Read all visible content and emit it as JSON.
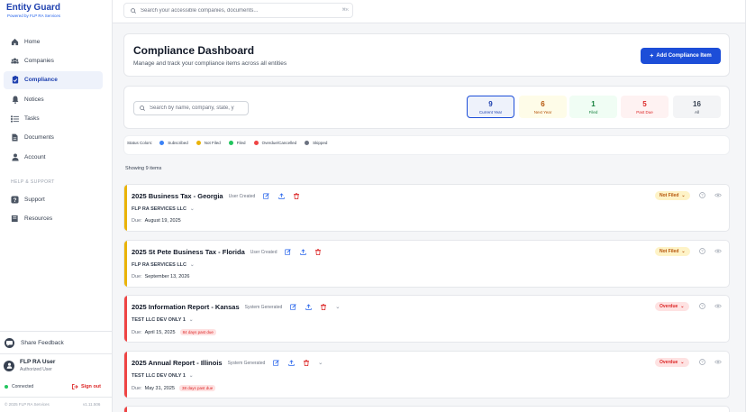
{
  "brand": {
    "title": "Entity Guard",
    "subtitle": "Powered by FLP RA Services"
  },
  "nav": {
    "items": [
      {
        "label": "Home",
        "icon": "home-icon"
      },
      {
        "label": "Companies",
        "icon": "users-icon"
      },
      {
        "label": "Compliance",
        "icon": "clipboard-icon"
      },
      {
        "label": "Notices",
        "icon": "bell-icon"
      },
      {
        "label": "Tasks",
        "icon": "list-icon"
      },
      {
        "label": "Documents",
        "icon": "document-icon"
      },
      {
        "label": "Account",
        "icon": "user-icon"
      }
    ],
    "section": "HELP & SUPPORT",
    "help_items": [
      {
        "label": "Support",
        "icon": "help-icon"
      },
      {
        "label": "Resources",
        "icon": "book-icon"
      }
    ]
  },
  "feedback": "Share Feedback",
  "user": {
    "name": "FLP RA User",
    "role": "Authorized User"
  },
  "status": {
    "connected": "Connected",
    "signout": "Sign out"
  },
  "footer": {
    "copyright": "© 2025 FLP RA Services",
    "version": "v1.11.506"
  },
  "topbar": {
    "search_placeholder": "Search your accessible companies, documents...",
    "shortcut": "⌘K"
  },
  "header": {
    "title": "Compliance Dashboard",
    "subtitle": "Manage and track your compliance items across all entities",
    "add_label": "Add Compliance Item"
  },
  "filter": {
    "search_placeholder": "Search by name, company, state, y",
    "stats": [
      {
        "count": "9",
        "label": "Current Year",
        "color": "#1e40af"
      },
      {
        "count": "6",
        "label": "Next Year",
        "color": "#b45309"
      },
      {
        "count": "1",
        "label": "Filed",
        "color": "#15803d"
      },
      {
        "count": "5",
        "label": "Past Due",
        "color": "#dc2626"
      },
      {
        "count": "16",
        "label": "All",
        "color": "#374151"
      }
    ]
  },
  "legend": {
    "label": "Status Colors:",
    "items": [
      {
        "label": "Subscribed",
        "color": "#3b82f6"
      },
      {
        "label": "Not Filed",
        "color": "#eab308"
      },
      {
        "label": "Filed",
        "color": "#22c55e"
      },
      {
        "label": "Overdue/Cancelled",
        "color": "#ef4444"
      },
      {
        "label": "Skipped",
        "color": "#6b7280"
      }
    ]
  },
  "showing": "Showing 9 items",
  "items": [
    {
      "title": "2025 Business Tax - Georgia",
      "source": "User Created",
      "company": "FLP RA SERVICES LLC",
      "due_label": "Due:",
      "due": "August 19, 2025",
      "past_due": "",
      "status": "Not Filed",
      "accent": "#eab308"
    },
    {
      "title": "2025 St Pete Business Tax - Florida",
      "source": "User Created",
      "company": "FLP RA SERVICES LLC",
      "due_label": "Due:",
      "due": "September 13, 2026",
      "past_due": "",
      "status": "Not Filed",
      "accent": "#eab308"
    },
    {
      "title": "2025 Information Report - Kansas",
      "source": "System Generated",
      "company": "TEST LLC DEV ONLY 1",
      "due_label": "Due:",
      "due": "April 15, 2025",
      "past_due": "84 days past due",
      "status": "Overdue",
      "accent": "#ef4444"
    },
    {
      "title": "2025 Annual Report - Illinois",
      "source": "System Generated",
      "company": "TEST LLC DEV ONLY 1",
      "due_label": "Due:",
      "due": "May 31, 2025",
      "past_due": "38 days past due",
      "status": "Overdue",
      "accent": "#ef4444"
    }
  ]
}
